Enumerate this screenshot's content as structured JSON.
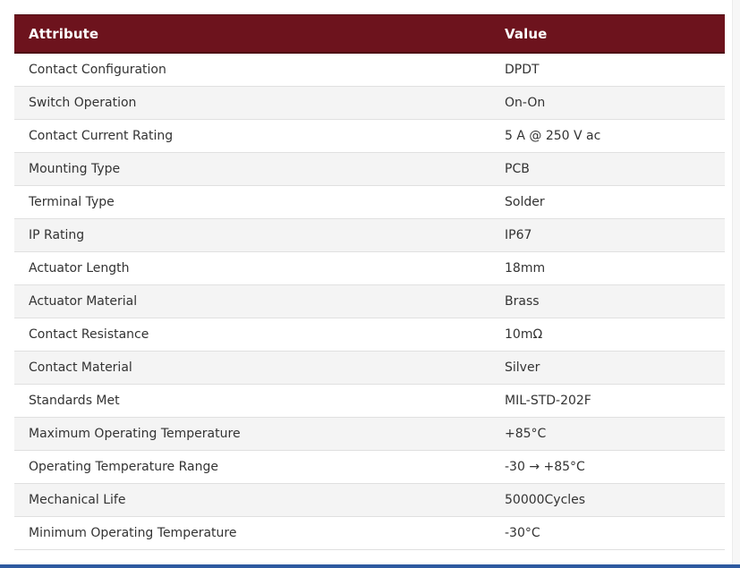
{
  "table": {
    "headers": {
      "attribute": "Attribute",
      "value": "Value"
    },
    "rows": [
      {
        "attribute": "Contact Configuration",
        "value": "DPDT"
      },
      {
        "attribute": "Switch Operation",
        "value": "On-On"
      },
      {
        "attribute": "Contact Current Rating",
        "value": "5 A @ 250 V ac"
      },
      {
        "attribute": "Mounting Type",
        "value": "PCB"
      },
      {
        "attribute": "Terminal Type",
        "value": "Solder"
      },
      {
        "attribute": "IP Rating",
        "value": "IP67"
      },
      {
        "attribute": "Actuator Length",
        "value": "18mm"
      },
      {
        "attribute": "Actuator Material",
        "value": "Brass"
      },
      {
        "attribute": "Contact Resistance",
        "value": "10mΩ"
      },
      {
        "attribute": "Contact Material",
        "value": "Silver"
      },
      {
        "attribute": "Standards Met",
        "value": "MIL-STD-202F"
      },
      {
        "attribute": "Maximum Operating Temperature",
        "value": "+85°C"
      },
      {
        "attribute": "Operating Temperature Range",
        "value": "-30 → +85°C"
      },
      {
        "attribute": "Mechanical Life",
        "value": "50000Cycles"
      },
      {
        "attribute": "Minimum Operating Temperature",
        "value": "-30°C"
      }
    ]
  },
  "colors": {
    "header_background": "#6d131d",
    "header_text": "#ffffff",
    "row_alt_background": "#f4f4f4",
    "bottom_bar": "#2e5aa0"
  }
}
